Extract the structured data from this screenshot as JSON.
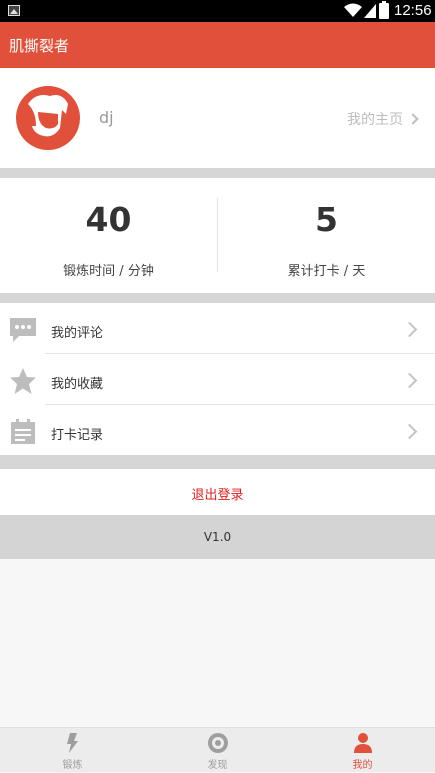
{
  "status_bar": {
    "time": "12:56"
  },
  "app_bar": {
    "title": "肌撕裂者"
  },
  "profile": {
    "username": "dj",
    "homepage_label": "我的主页"
  },
  "stats": [
    {
      "value": "40",
      "label": "锻炼时间 / 分钟"
    },
    {
      "value": "5",
      "label": "累计打卡 / 天"
    }
  ],
  "menu": [
    {
      "label": "我的评论",
      "icon": "comment-icon"
    },
    {
      "label": "我的收藏",
      "icon": "star-icon"
    },
    {
      "label": "打卡记录",
      "icon": "calendar-icon"
    }
  ],
  "logout_label": "退出登录",
  "version_label": "V1.0",
  "bottom_nav": [
    {
      "label": "锻炼",
      "icon": "lightning-icon",
      "active": false
    },
    {
      "label": "发现",
      "icon": "target-icon",
      "active": false
    },
    {
      "label": "我的",
      "icon": "person-icon",
      "active": true
    }
  ],
  "colors": {
    "accent": "#e0503a",
    "logout": "#e02020"
  }
}
